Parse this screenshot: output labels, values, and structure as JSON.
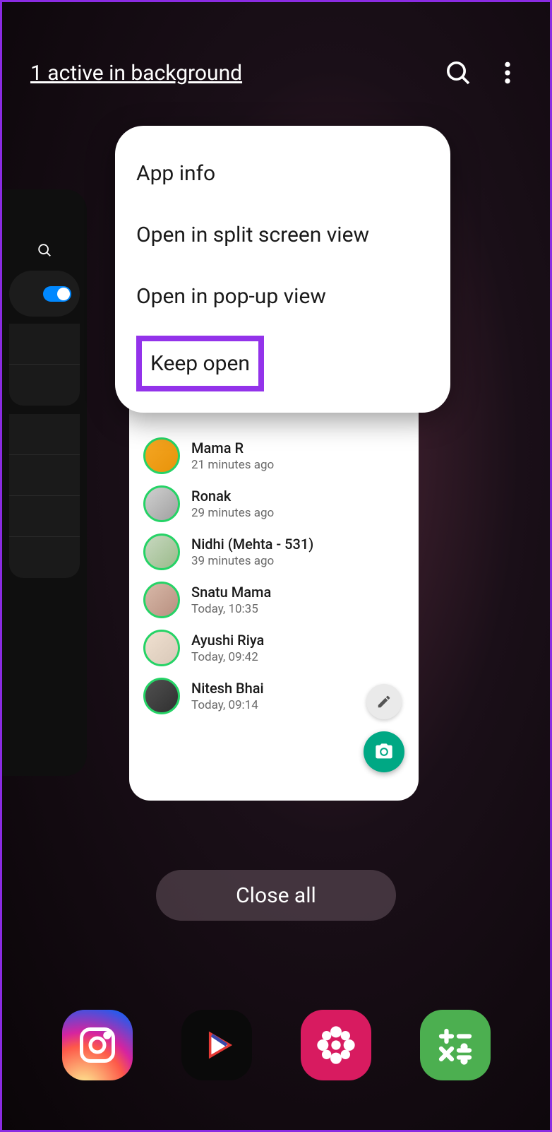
{
  "topBar": {
    "backgroundLink": "1 active in background"
  },
  "popupMenu": {
    "items": [
      "App info",
      "Open in split screen view",
      "Open in pop-up view",
      "Keep open"
    ]
  },
  "contacts": [
    {
      "name": "Mama R",
      "time": "21 minutes ago"
    },
    {
      "name": "Ronak",
      "time": "29 minutes ago"
    },
    {
      "name": "Nidhi (Mehta - 531)",
      "time": "39 minutes ago"
    },
    {
      "name": "Snatu Mama",
      "time": "Today, 10:35"
    },
    {
      "name": "Ayushi Riya",
      "time": "Today, 09:42"
    },
    {
      "name": "Nitesh Bhai",
      "time": "Today, 09:14"
    }
  ],
  "closeAll": "Close all"
}
